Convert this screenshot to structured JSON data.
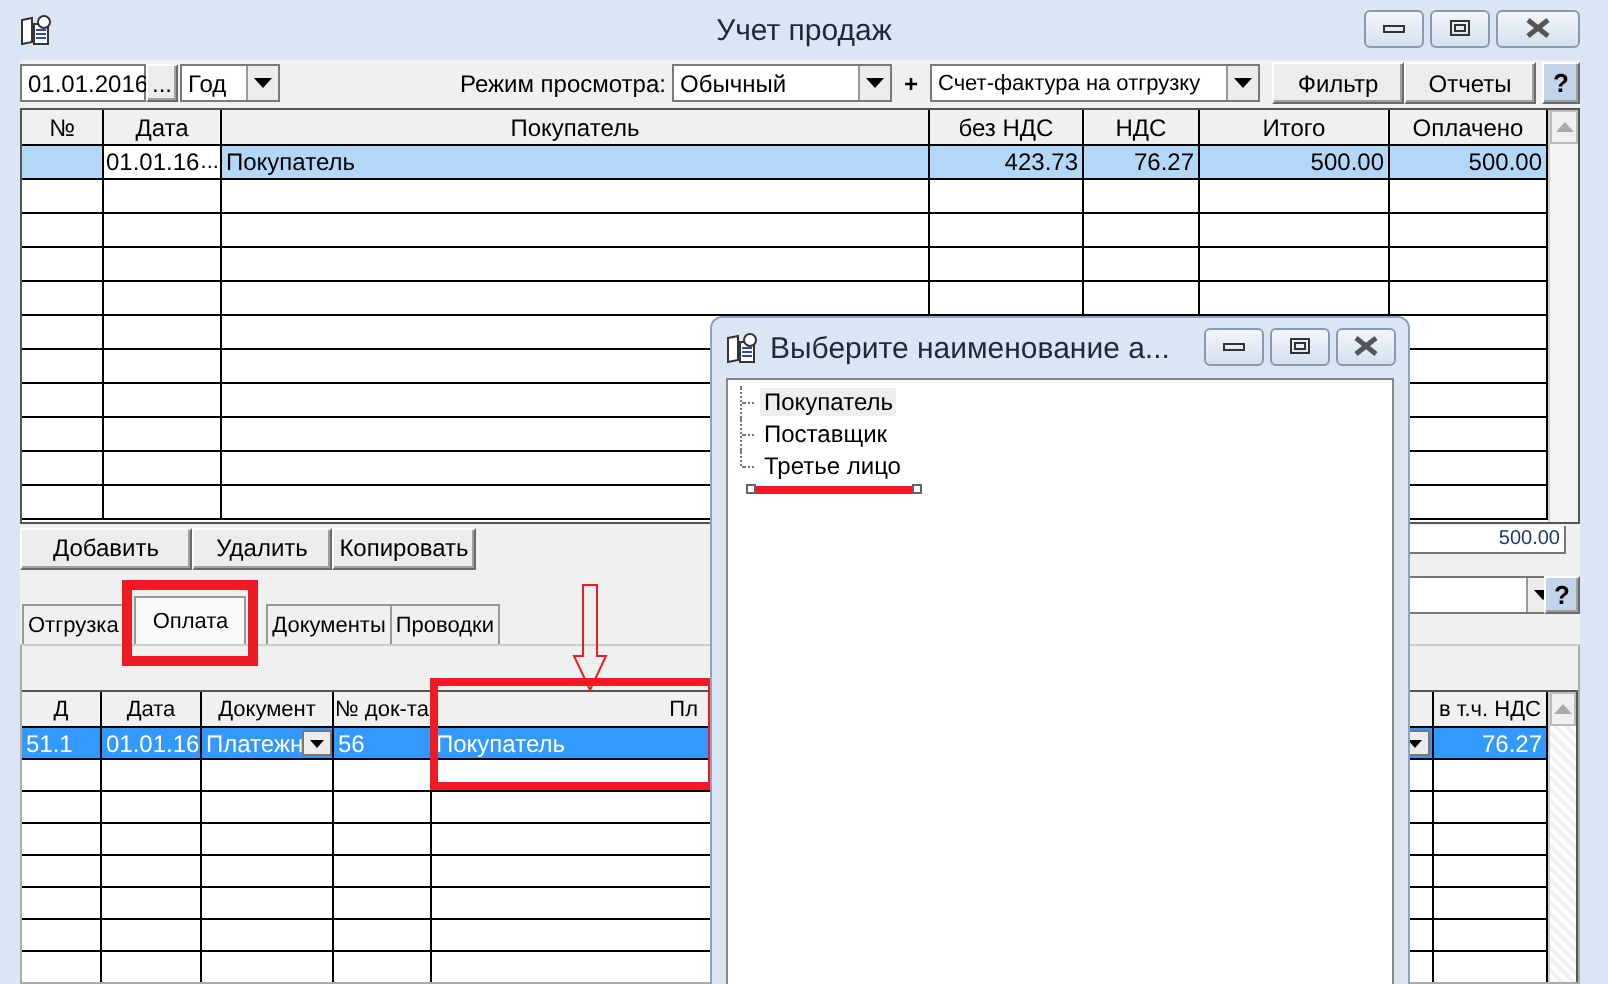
{
  "window": {
    "title": "Учет продаж"
  },
  "toolbar": {
    "date": "01.01.2016",
    "date_button": "...",
    "period": "Год",
    "view_mode_label": "Режим просмотра:",
    "view_mode": "Обычный",
    "plus": "+",
    "document_type": "Счет-фактура на отгрузку",
    "buttons": [
      "Фильтр",
      "Отчеты"
    ],
    "help": "?"
  },
  "sales_table": {
    "columns": [
      "№",
      "Дата",
      "Покупатель",
      "без НДС",
      "НДС",
      "Итого",
      "Оплачено"
    ],
    "rows": [
      {
        "cells": [
          "",
          "01.01.16",
          "Покупатель",
          "423.73",
          "76.27",
          "500.00",
          "500.00"
        ],
        "date_button": "...",
        "selected": true
      }
    ]
  },
  "actions": [
    "Добавить",
    "Удалить",
    "Копировать"
  ],
  "total": "500.00",
  "filter_combo": {
    "help": "?"
  },
  "tabs": [
    {
      "label": "Отгрузка",
      "selected": false
    },
    {
      "label": "Оплата",
      "selected": true
    },
    {
      "label": "Документы",
      "selected": false
    },
    {
      "label": "Проводки",
      "selected": false
    }
  ],
  "payments_table": {
    "columns": [
      "Д",
      "Дата",
      "Документ",
      "№ док-та",
      "Пл",
      "в т.ч. НДС"
    ],
    "rows": [
      {
        "cells": [
          "51.1",
          "01.01.16",
          "Платежн",
          "56",
          "Покупатель",
          "76.27"
        ],
        "selected": true
      }
    ]
  },
  "dialog": {
    "title": "Выберите наименование а...",
    "tree": [
      {
        "label": "Покупатель",
        "selected": true
      },
      {
        "label": "Поставщик",
        "selected": false
      },
      {
        "label": "Третье лицо",
        "selected": false
      }
    ]
  }
}
